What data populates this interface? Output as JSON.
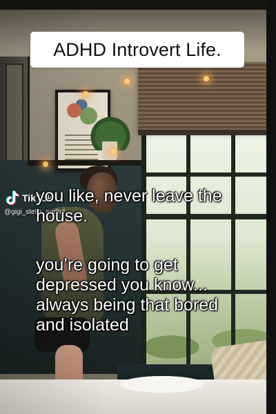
{
  "overlay": {
    "title": "ADHD Introvert Life."
  },
  "watermark": {
    "brand": "TikTok",
    "username": "@gigi_stella_audhd",
    "icon": "tiktok-music-note-icon"
  },
  "captions": [
    {
      "lines": [
        "you like, never leave the",
        "house."
      ]
    },
    {
      "lines": [
        "you’re going to get",
        "depressed you know...",
        "always being that bored",
        "and isolated"
      ]
    }
  ],
  "colors": {
    "title_bg": "#ffffff",
    "title_text": "#101010",
    "caption_text": "#ffffff",
    "tiktok_cyan": "#25f4ee",
    "tiktok_red": "#fe2c55"
  }
}
